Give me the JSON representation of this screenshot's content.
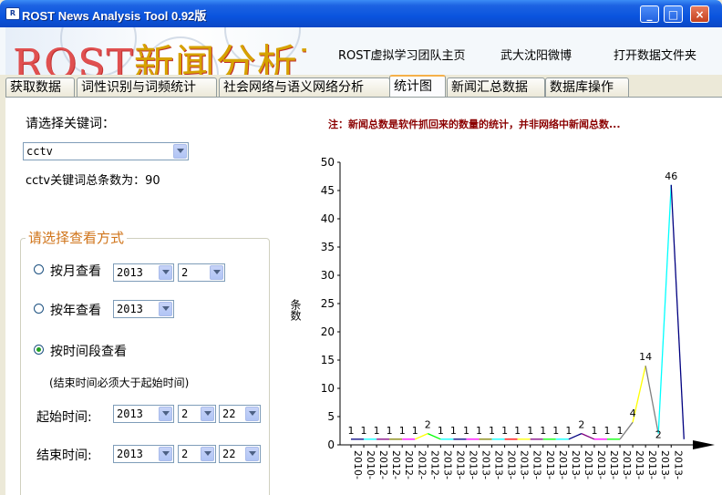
{
  "window": {
    "title": "ROST News Analysis Tool 0.92版",
    "minimize": "_",
    "maximize": "□",
    "close": "×"
  },
  "header": {
    "banner_text_1": "ROST",
    "banner_text_2": "新闻分析工具",
    "links": [
      "ROST虚拟学习团队主页",
      "武大沈阳微博",
      "打开数据文件夹"
    ]
  },
  "tabs": [
    {
      "label": "获取数据",
      "active": false
    },
    {
      "label": "词性识别与词频统计",
      "active": false
    },
    {
      "label": "社会网络与语义网络分析",
      "active": false
    },
    {
      "label": "统计图",
      "active": true
    },
    {
      "label": "新闻汇总数据",
      "active": false
    },
    {
      "label": "数据库操作",
      "active": false
    }
  ],
  "left": {
    "keyword_label": "请选择关键词：",
    "keyword_value": "cctv",
    "total_label": "cctv关键词总条数为：",
    "total_value": "90",
    "group_title": "请选择查看方式",
    "by_month_label": "按月查看",
    "by_month_year": "2013",
    "by_month_month": "2",
    "by_year_label": "按年查看",
    "by_year_year": "2013",
    "by_range_label": "按时间段查看",
    "range_note": "(结束时间必须大于起始时间)",
    "start_label": "起始时间:",
    "start_year": "2013",
    "start_month": "2",
    "start_day": "22",
    "end_label": "结束时间:",
    "end_year": "2013",
    "end_month": "2",
    "end_day": "22",
    "selected_mode": "range"
  },
  "note": "注：新闻总数是软件抓回来的数量的统计，并非网络中新闻总数...",
  "chart_data": {
    "type": "line",
    "ylabel": "条数",
    "ylim": [
      0,
      50
    ],
    "yticks": [
      0,
      5,
      10,
      15,
      20,
      25,
      30,
      35,
      40,
      45,
      50
    ],
    "x": [
      "2010-",
      "2010-",
      "2012-",
      "2012-",
      "2012-",
      "2012-",
      "2012-",
      "2013-",
      "2013-",
      "2013-",
      "2013-",
      "2013-",
      "2013-",
      "2013-",
      "2013-",
      "2013-",
      "2013-",
      "2013-",
      "2013-",
      "2013-",
      "2013-",
      "2013-",
      "2013-",
      "2013-",
      "2013-",
      "2013-"
    ],
    "values": [
      1,
      1,
      1,
      1,
      1,
      1,
      2,
      1,
      1,
      1,
      1,
      1,
      1,
      1,
      1,
      1,
      1,
      1,
      2,
      1,
      1,
      1,
      4,
      14,
      2,
      46,
      1
    ],
    "data_labels": [
      "1",
      "1",
      "1",
      "1",
      "1",
      "1",
      "2",
      "1",
      "1",
      "1",
      "1",
      "1",
      "1",
      "1",
      "1",
      "1",
      "1",
      "1",
      "2",
      "1",
      "1",
      "1",
      "4",
      "14",
      "2",
      "46"
    ],
    "segment_colors": [
      "#000080",
      "#00ffff",
      "#800080",
      "#808000",
      "#ff00ff",
      "#ffff00",
      "#00ff00",
      "#00ffff",
      "#000080",
      "#ff00ff",
      "#808000",
      "#00ffff",
      "#ff0000",
      "#ffff00",
      "#800080",
      "#00ff00",
      "#00ffff",
      "#000080",
      "#800080",
      "#ff00ff",
      "#00ff00",
      "#808080",
      "#ffff00",
      "#808080",
      "#00ffff",
      "#000080"
    ]
  }
}
